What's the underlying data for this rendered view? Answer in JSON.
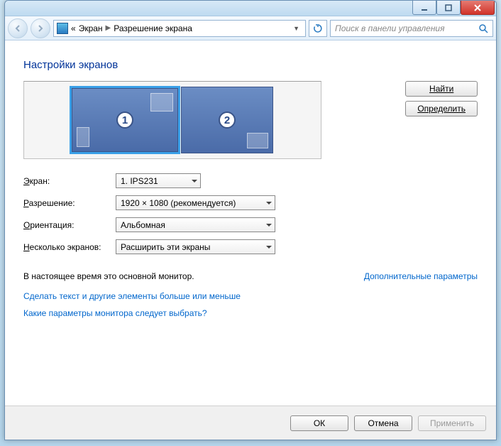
{
  "titlebar": {
    "minimize_icon": "minimize",
    "maximize_icon": "maximize",
    "close_icon": "close"
  },
  "nav": {
    "back_icon": "back",
    "forward_icon": "forward",
    "breadcrumb_prefix": "«",
    "breadcrumb_1": "Экран",
    "breadcrumb_2": "Разрешение экрана",
    "refresh_icon": "refresh",
    "search_placeholder": "Поиск в панели управления",
    "search_icon": "search"
  },
  "page": {
    "title": "Настройки экранов",
    "find_button": "Найти",
    "identify_button": "Определить",
    "monitor_1_label": "1",
    "monitor_2_label": "2"
  },
  "form": {
    "display_label": "Экран:",
    "display_value": "1. IPS231",
    "resolution_label": "Разрешение:",
    "resolution_value": "1920 × 1080 (рекомендуется)",
    "orientation_label": "Ориентация:",
    "orientation_value": "Альбомная",
    "multiple_label": "Несколько экранов:",
    "multiple_value": "Расширить эти экраны"
  },
  "status": {
    "primary_text": "В настоящее время это основной монитор.",
    "advanced_link": "Дополнительные параметры"
  },
  "links": {
    "text_size": "Сделать текст и другие элементы больше или меньше",
    "projector": "Какие параметры монитора следует выбрать?"
  },
  "footer": {
    "ok": "ОК",
    "cancel": "Отмена",
    "apply": "Применить"
  }
}
